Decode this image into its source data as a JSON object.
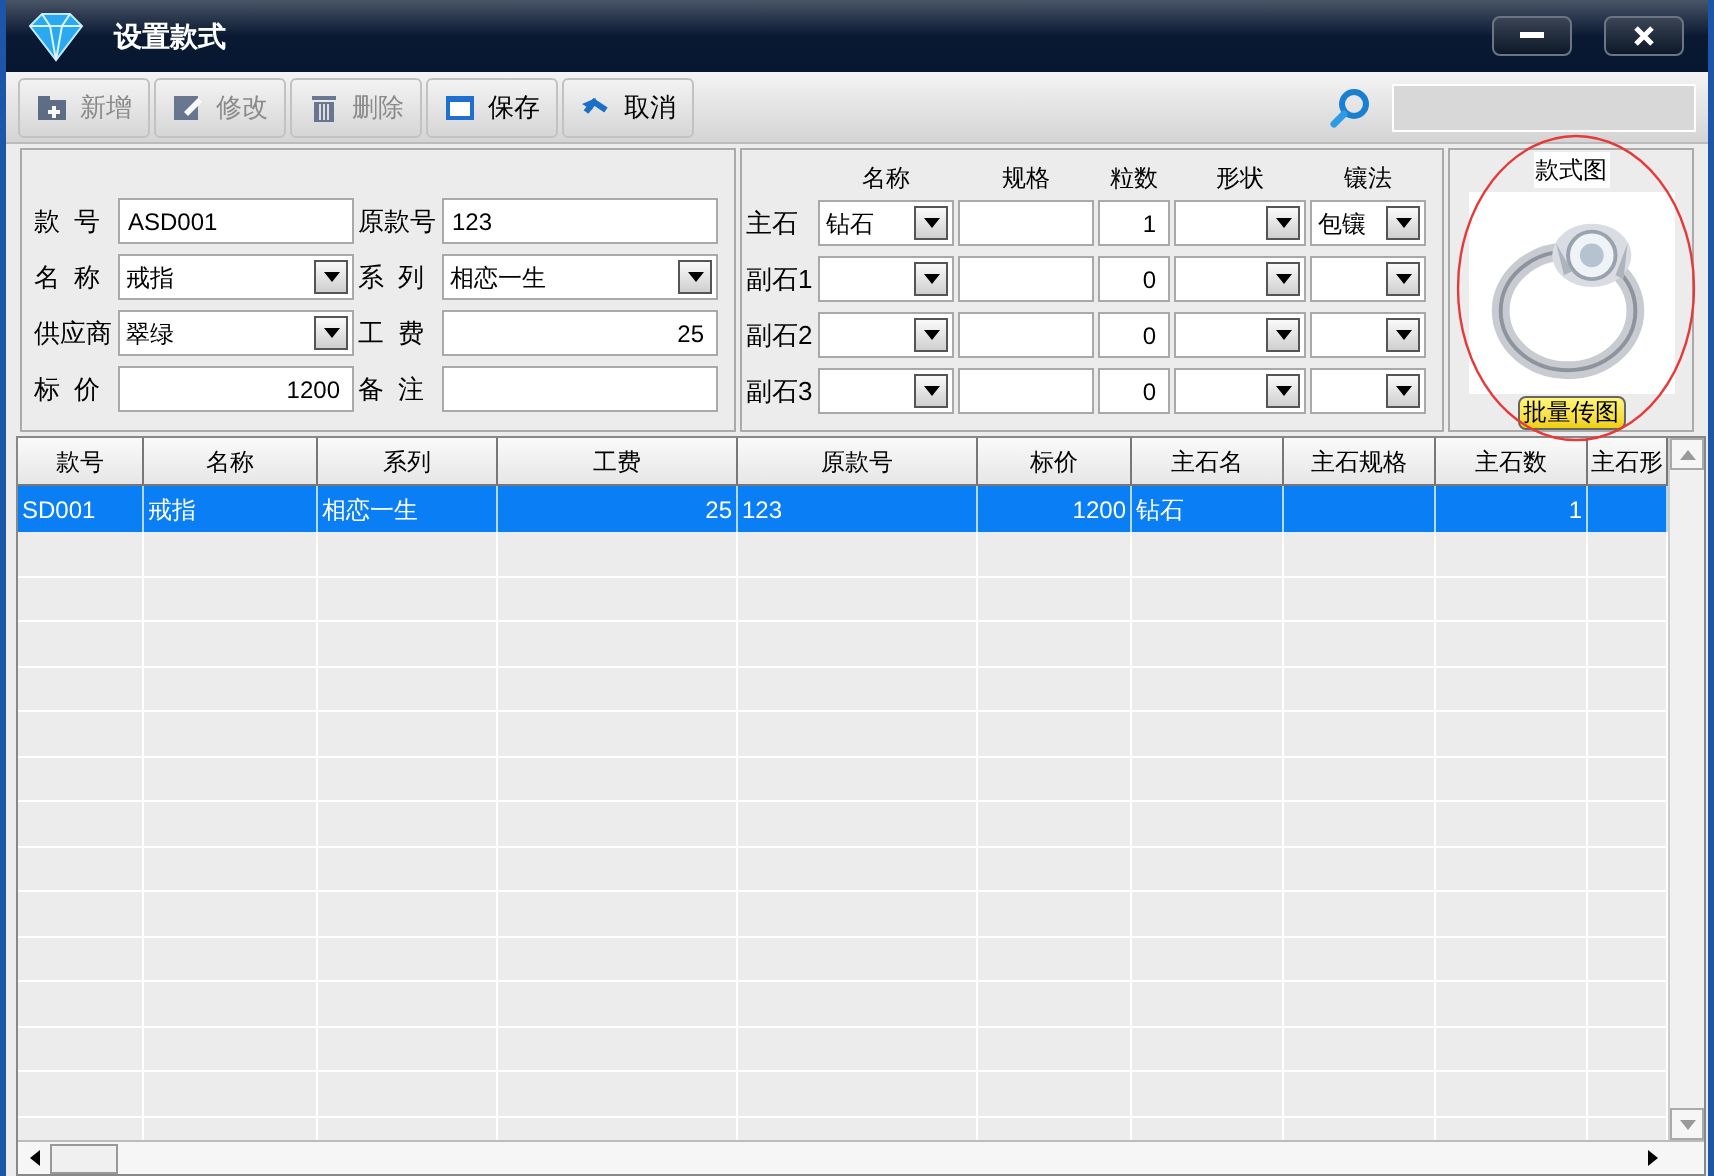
{
  "window": {
    "title": "设置款式"
  },
  "toolbar": {
    "buttons": [
      {
        "label": "新增",
        "disabled": true,
        "kind": "add"
      },
      {
        "label": "修改",
        "disabled": true,
        "kind": "edit"
      },
      {
        "label": "删除",
        "disabled": true,
        "kind": "delete"
      },
      {
        "label": "保存",
        "disabled": false,
        "kind": "save"
      },
      {
        "label": "取消",
        "disabled": false,
        "kind": "cancel"
      }
    ]
  },
  "form": {
    "fields": [
      {
        "label": "款  号",
        "value": "ASD001",
        "kind": "text"
      },
      {
        "label": "原款号",
        "value": "123",
        "kind": "text"
      },
      {
        "label": "名  称",
        "value": "戒指",
        "kind": "select"
      },
      {
        "label": "系  列",
        "value": "相恋一生",
        "kind": "select"
      },
      {
        "label": "供应商",
        "value": "翠绿",
        "kind": "select"
      },
      {
        "label": "工  费",
        "value": "25",
        "kind": "number"
      },
      {
        "label": "标  价",
        "value": "1200",
        "kind": "number"
      },
      {
        "label": "备  注",
        "kind": "text"
      }
    ]
  },
  "stones": {
    "columns": [
      "名称",
      "规格",
      "粒数",
      "形状",
      "镶法"
    ],
    "rows": [
      {
        "label": "主石",
        "name": "钻石",
        "count": "1",
        "setting": "包镶"
      },
      {
        "label": "副石1",
        "count": "0"
      },
      {
        "label": "副石2",
        "count": "0"
      },
      {
        "label": "副石3",
        "count": "0"
      }
    ]
  },
  "image_panel": {
    "title": "款式图",
    "button": "批量传图"
  },
  "table": {
    "columns": [
      "款号",
      "名称",
      "系列",
      "工费",
      "原款号",
      "标价",
      "主石名",
      "主石规格",
      "主石数",
      "主石形"
    ],
    "rows": [
      {
        "cells": [
          "SD001",
          "戒指",
          "相恋一生",
          "25",
          "123",
          "1200",
          "钻石",
          null,
          "1",
          null
        ],
        "selected": true
      }
    ]
  }
}
